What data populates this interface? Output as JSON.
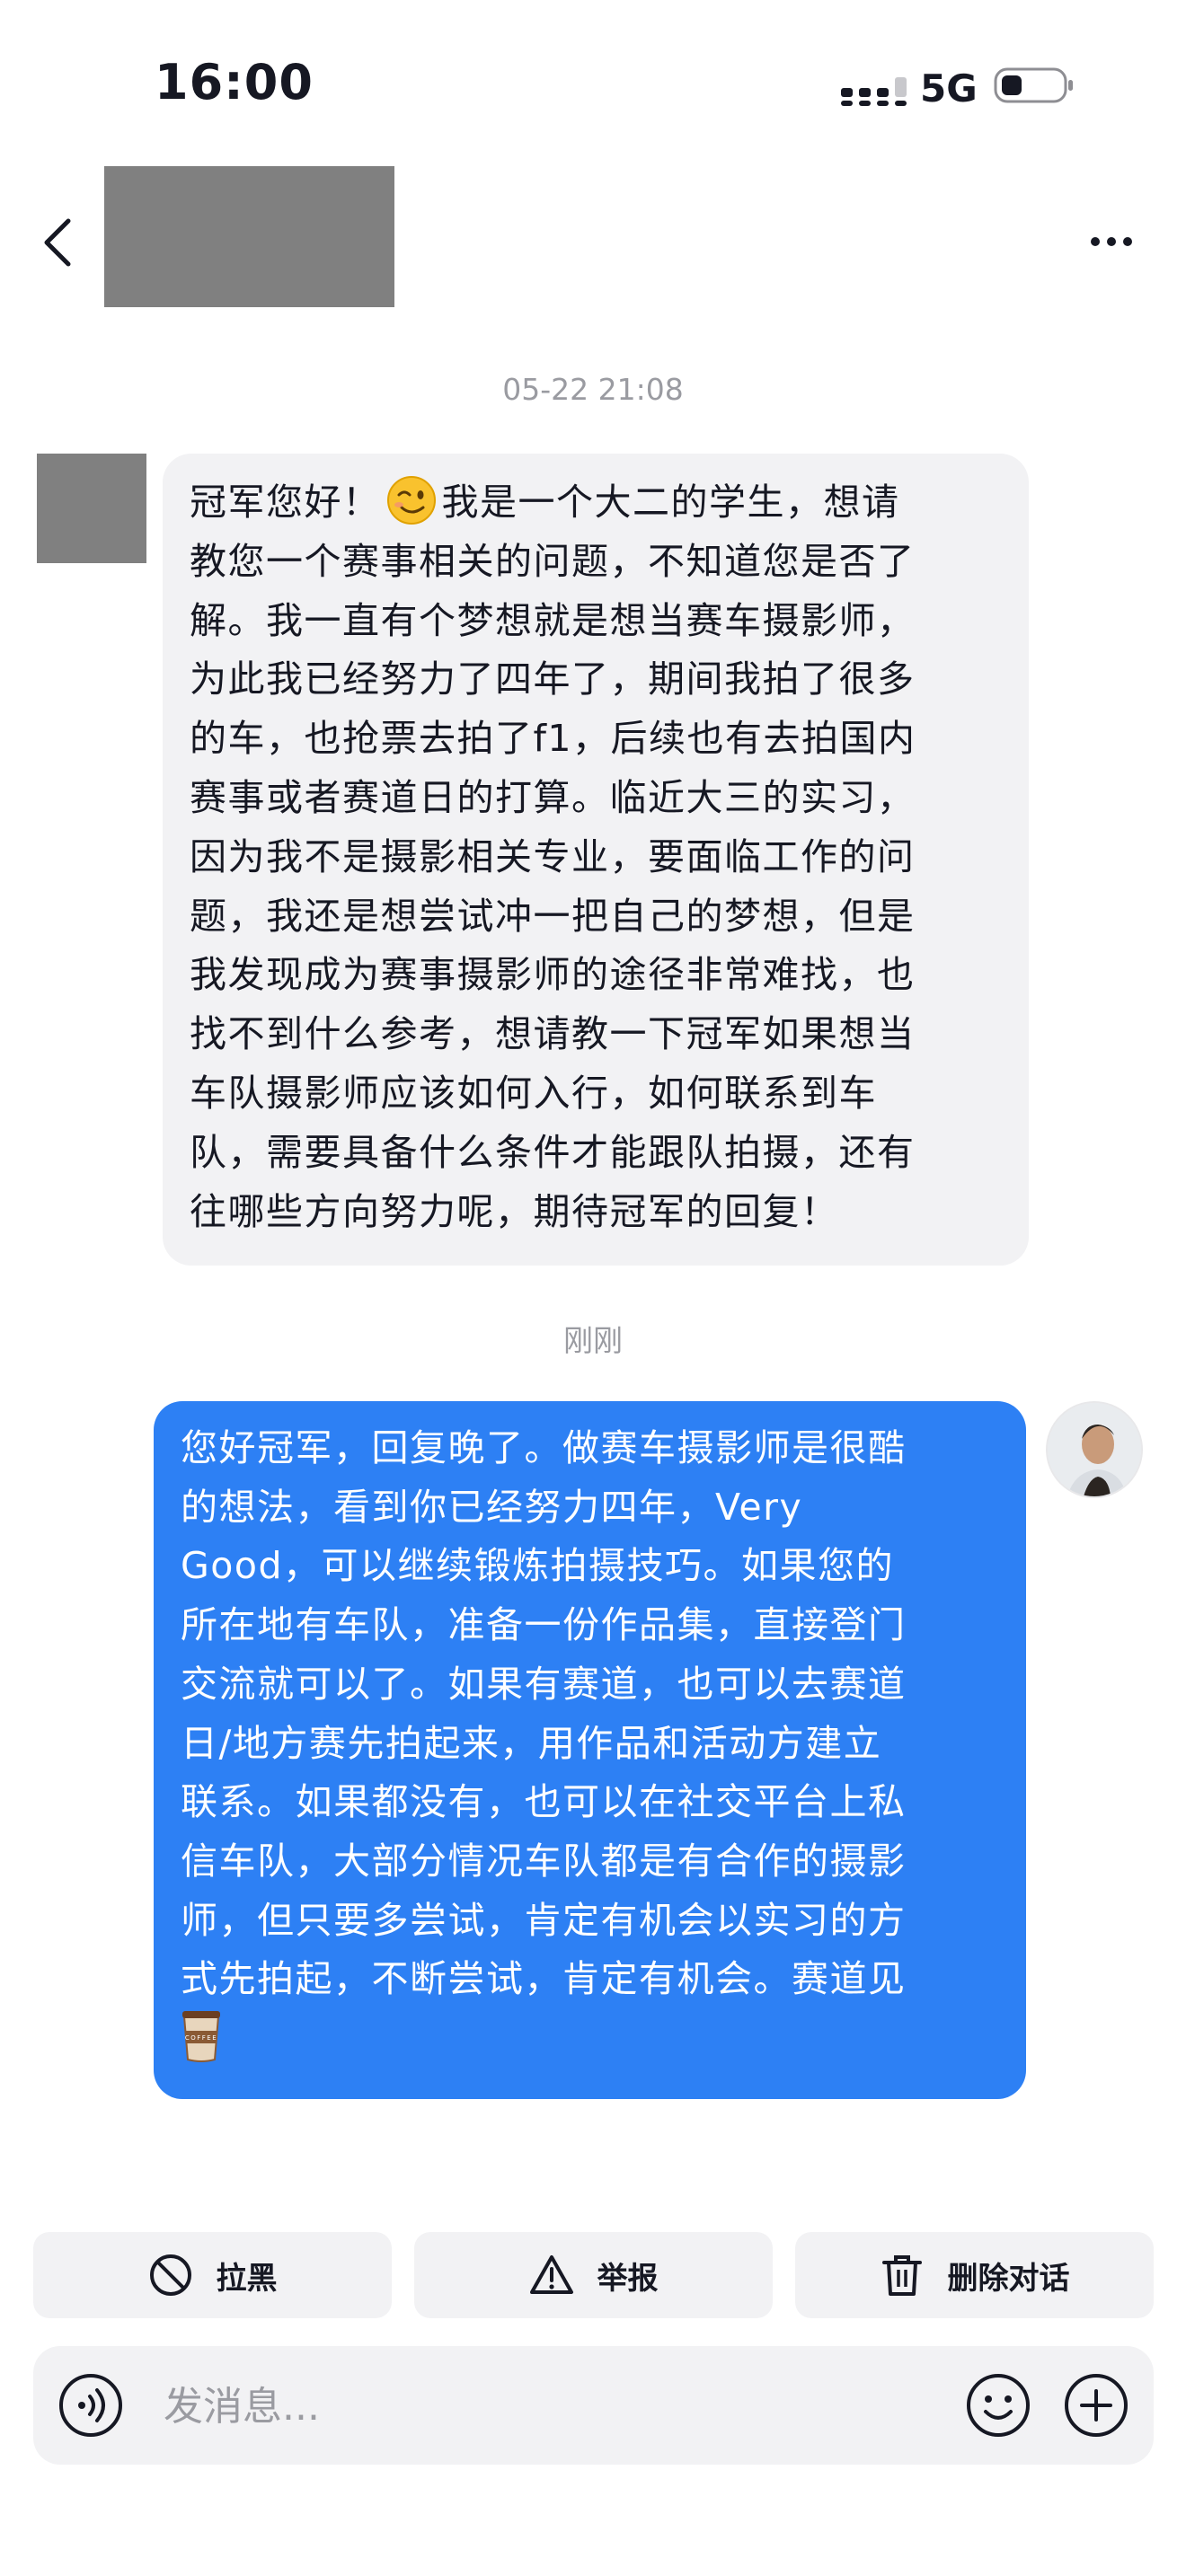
{
  "status_bar": {
    "time": "16:00",
    "network": "5G"
  },
  "header": {
    "back_icon": "chevron-left-icon",
    "more_icon": "more-dots-icon"
  },
  "conversation": {
    "timestamp_1": "05-22 21:08",
    "incoming": {
      "lines": [
        "冠军您好！",
        "我是一个大二的学生，想请",
        "教您一个赛事相关的问题，不知道您是否了",
        "解。我一直有个梦想就是想当赛车摄影师，",
        "为此我已经努力了四年了，期间我拍了很多",
        "的车，也抢票去拍了f1，后续也有去拍国内",
        "赛事或者赛道日的打算。临近大三的实习，",
        "因为我不是摄影相关专业，要面临工作的问",
        "题，我还是想尝试冲一把自己的梦想，但是",
        "我发现成为赛事摄影师的途径非常难找，也",
        "找不到什么参考，想请教一下冠军如果想当",
        "车队摄影师应该如何入行，如何联系到车",
        "队，需要具备什么条件才能跟队拍摄，还有",
        "往哪些方向努力呢，期待冠军的回复！"
      ],
      "emoji": "winking-face-emoji"
    },
    "timestamp_2": "刚刚",
    "outgoing": {
      "lines": [
        "您好冠军，回复晚了。做赛车摄影师是很酷",
        "的想法，看到你已经努力四年，Very",
        "Good，可以继续锻炼拍摄技巧。如果您的",
        "所在地有车队，准备一份作品集，直接登门",
        "交流就可以了。如果有赛道，也可以去赛道",
        "日/地方赛先拍起来，用作品和活动方建立",
        "联系。如果都没有，也可以在社交平台上私",
        "信车队，大部分情况车队都是有合作的摄影",
        "师，但只要多尝试，肯定有机会以实习的方",
        "式先拍起，不断尝试，肯定有机会。赛道见"
      ],
      "emoji": "coffee-emoji",
      "emoji_label": "COFFEE"
    }
  },
  "actions": [
    {
      "label": "拉黑",
      "icon": "block-icon"
    },
    {
      "label": "举报",
      "icon": "warning-icon"
    },
    {
      "label": "删除对话",
      "icon": "trash-icon"
    }
  ],
  "composer": {
    "placeholder": "发消息...",
    "voice_icon": "voice-icon",
    "emoji_icon": "smiley-icon",
    "plus_icon": "plus-icon"
  },
  "colors": {
    "accent_blue": "#2d80f4",
    "incoming_bubble": "#f2f2f4",
    "muted_text": "#9a9ba1"
  }
}
